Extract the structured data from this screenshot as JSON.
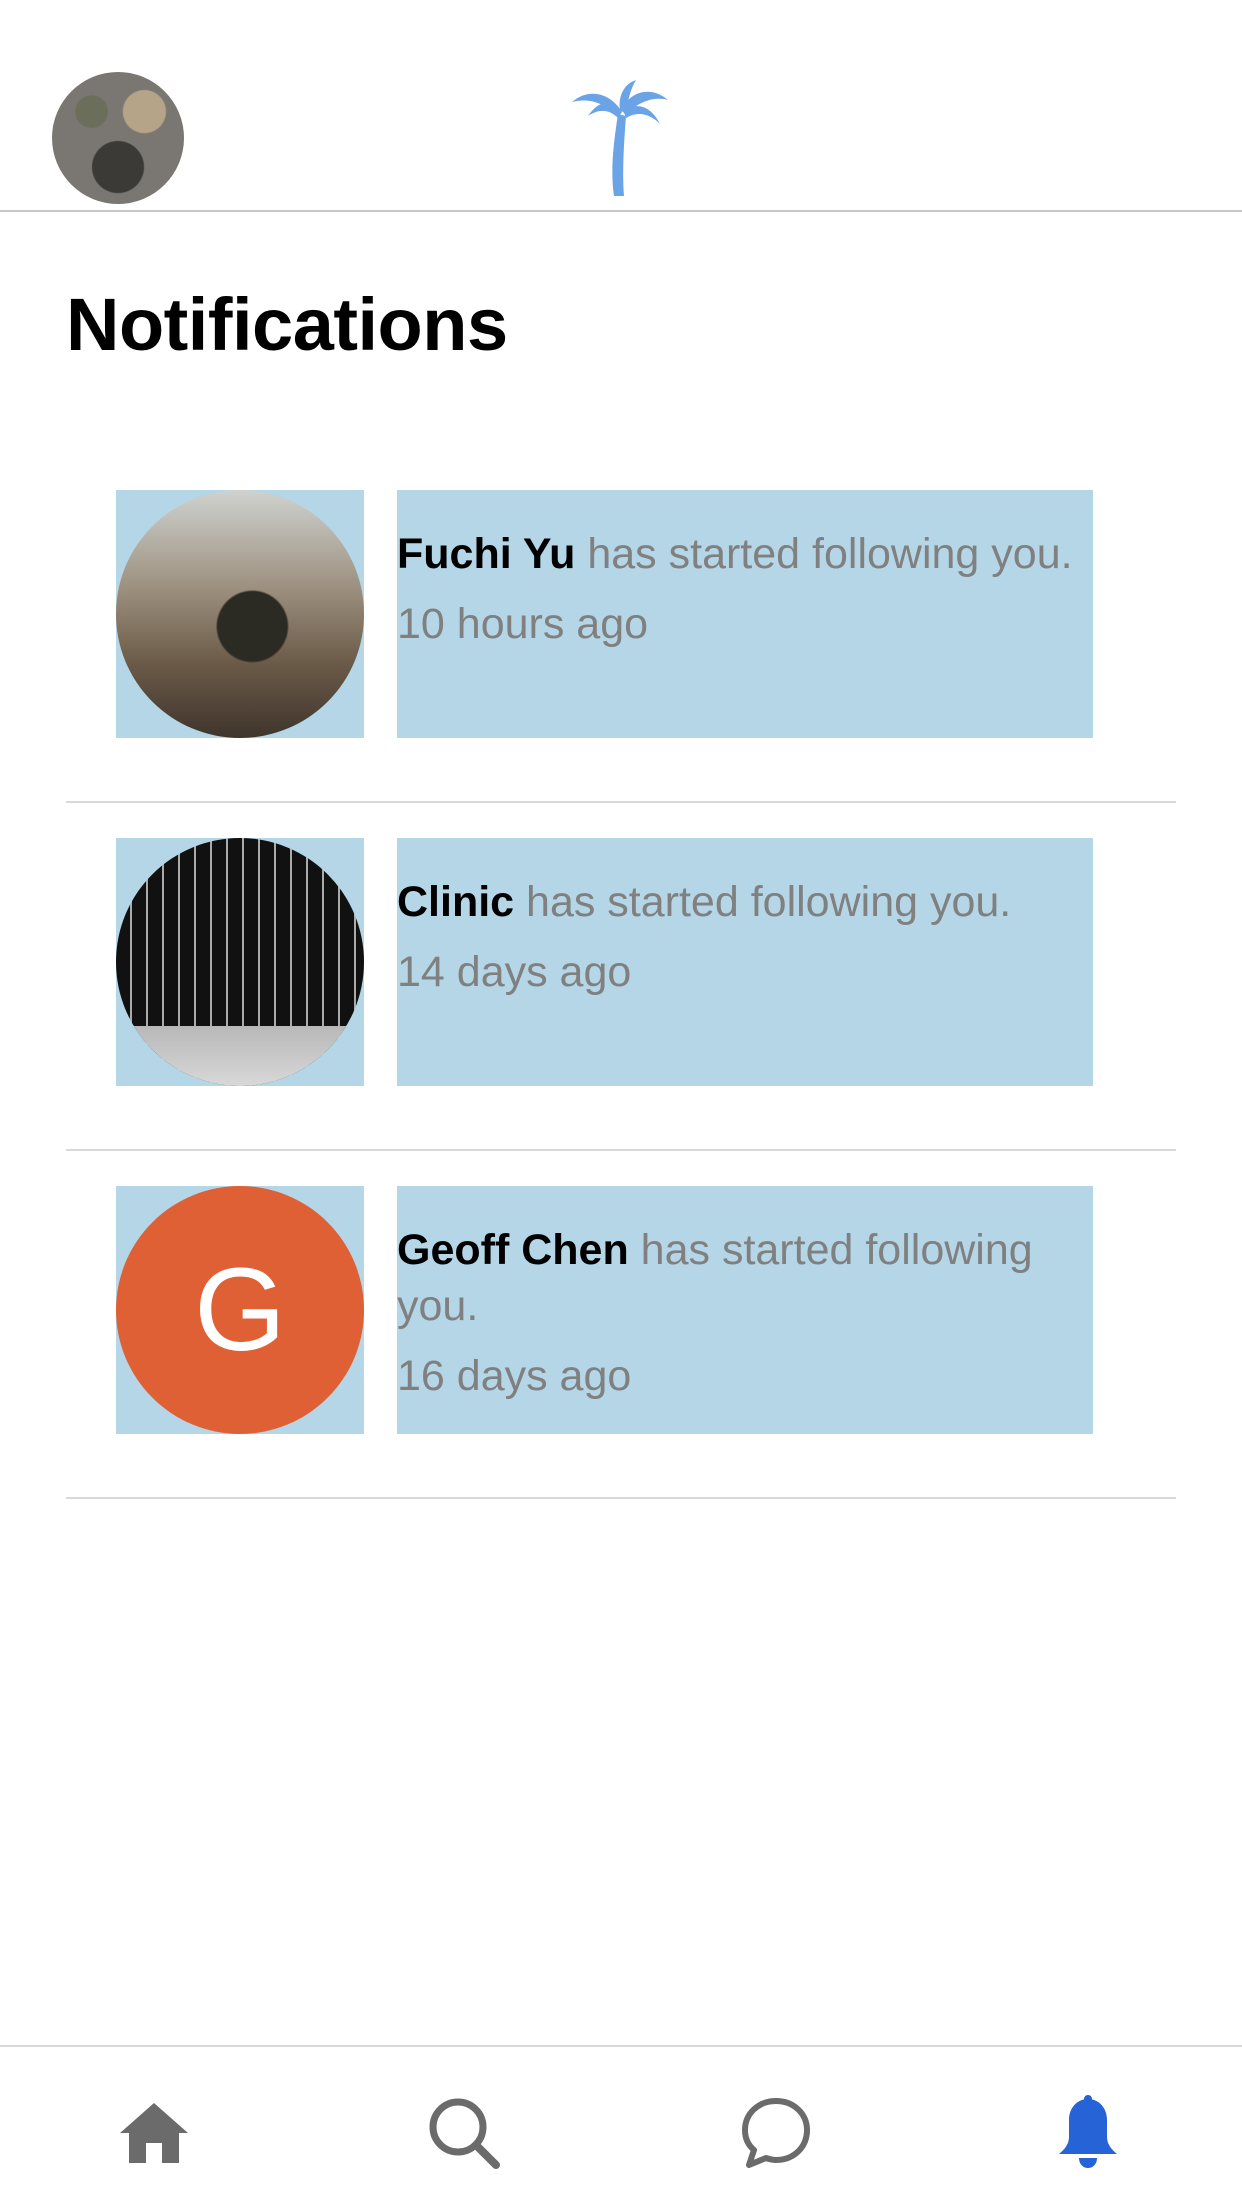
{
  "header": {
    "profile_avatar_icon": "profile-photo",
    "logo_icon": "palm-tree-icon",
    "logo_color": "#6aa3e6"
  },
  "page": {
    "title": "Notifications"
  },
  "notifications": [
    {
      "name": "Fuchi Yu",
      "action": " has started following you.",
      "time": "10 hours ago",
      "avatar": "photo"
    },
    {
      "name": "Clinic",
      "action": " has started following you.",
      "time": "14 days ago",
      "avatar": "photo"
    },
    {
      "name": "Geoff Chen",
      "action": " has started following you.",
      "time": "16 days ago",
      "avatar": "letter",
      "avatar_letter": "G",
      "avatar_color": "#e06035"
    }
  ],
  "tabbar": {
    "tabs": [
      {
        "icon": "home-icon",
        "active": false
      },
      {
        "icon": "search-icon",
        "active": false
      },
      {
        "icon": "chat-icon",
        "active": false
      },
      {
        "icon": "bell-icon",
        "active": true
      }
    ],
    "inactive_color": "#6b6b6b",
    "active_color": "#2563d6"
  },
  "colors": {
    "highlight_bg": "#b4d6e6",
    "secondary_text": "#808080"
  }
}
